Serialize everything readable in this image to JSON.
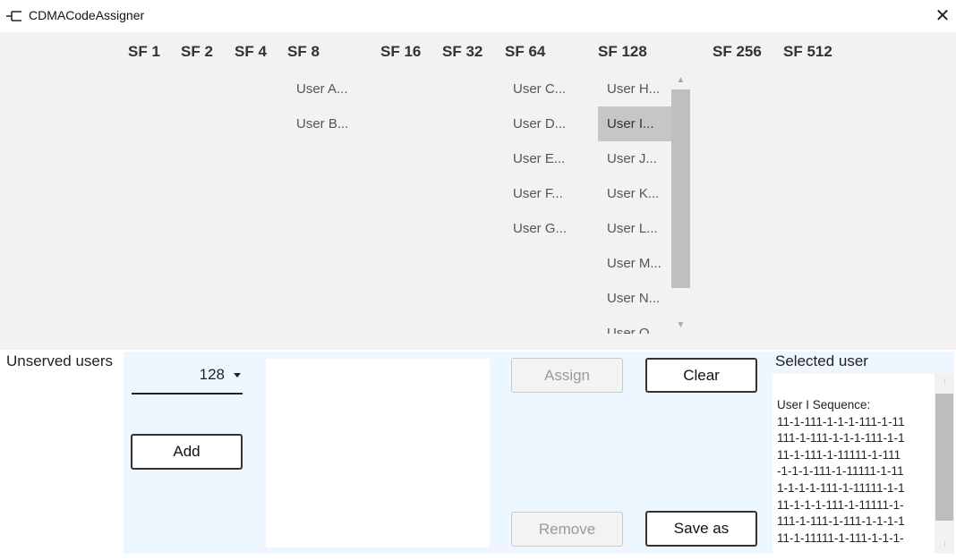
{
  "window": {
    "title": "CDMACodeAssigner",
    "close_symbol": "✕"
  },
  "spreading_factors": [
    {
      "label": "SF 1"
    },
    {
      "label": "SF 2"
    },
    {
      "label": "SF 4"
    },
    {
      "label": "SF 8"
    },
    {
      "label": "SF 16"
    },
    {
      "label": "SF 32"
    },
    {
      "label": "SF 64"
    },
    {
      "label": "SF 128"
    },
    {
      "label": "SF 256"
    },
    {
      "label": "SF 512"
    }
  ],
  "sf8_users": [
    "User A...",
    "User B..."
  ],
  "sf64_users": [
    "User C...",
    "User D...",
    "User E...",
    "User F...",
    "User G..."
  ],
  "sf128_users": [
    "User H...",
    "User I...",
    "User J...",
    "User K...",
    "User L...",
    "User M...",
    "User N...",
    "User O..."
  ],
  "sf128_selected_index": 1,
  "unserved": {
    "label": "Unserved users",
    "sf_value": "128",
    "add_label": "Add",
    "assign_label": "Assign",
    "clear_label": "Clear",
    "remove_label": "Remove",
    "save_as_label": "Save as"
  },
  "selected_user": {
    "label": "Selected user",
    "sequence_text": "User I Sequence:\n11-1-111-1-1-1-111-1-11\n111-1-111-1-1-1-111-1-1\n11-1-111-1-11111-1-111\n-1-1-1-111-1-11111-1-11\n1-1-1-1-111-1-11111-1-1\n11-1-1-1-111-1-11111-1-\n111-1-111-1-111-1-1-1-1\n11-1-11111-1-111-1-1-1-"
  }
}
